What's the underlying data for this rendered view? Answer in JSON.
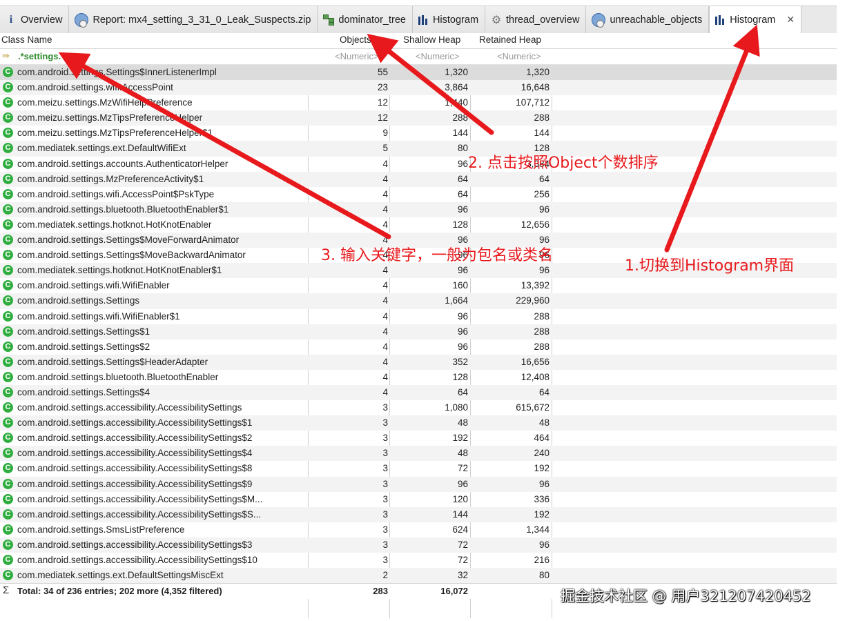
{
  "tabs": [
    {
      "icon": "info-icon",
      "label": "Overview",
      "active": false
    },
    {
      "icon": "report-icon",
      "label": "Report: mx4_setting_3_31_0_Leak_Suspects.zip",
      "active": false
    },
    {
      "icon": "tree-icon",
      "label": "dominator_tree",
      "active": false
    },
    {
      "icon": "histogram-icon",
      "label": "Histogram",
      "active": false
    },
    {
      "icon": "gear-icon",
      "label": "thread_overview",
      "active": false
    },
    {
      "icon": "report-icon",
      "label": "unreachable_objects",
      "active": false
    },
    {
      "icon": "histogram-icon",
      "label": "Histogram",
      "active": true,
      "close": "✕"
    }
  ],
  "columns": {
    "class_name": "Class Name",
    "objects": "Objects",
    "objects_sort": "⌄",
    "shallow": "Shallow Heap",
    "retained": "Retained Heap"
  },
  "filter": {
    "class_name": ".*settings.*",
    "objects": "<Numeric>",
    "shallow": "<Numeric>",
    "retained": "<Numeric>"
  },
  "rows": [
    {
      "name": "com.android.settings.Settings$InnerListenerImpl",
      "objects": "55",
      "shallow": "1,320",
      "retained": "1,320"
    },
    {
      "name": "com.android.settings.wifi.AccessPoint",
      "objects": "23",
      "shallow": "3,864",
      "retained": "16,648"
    },
    {
      "name": "com.meizu.settings.MzWifiHelpPreference",
      "objects": "12",
      "shallow": "1,440",
      "retained": "107,712"
    },
    {
      "name": "com.meizu.settings.MzTipsPreferenceHelper",
      "objects": "12",
      "shallow": "288",
      "retained": "288"
    },
    {
      "name": "com.meizu.settings.MzTipsPreferenceHelper$1",
      "objects": "9",
      "shallow": "144",
      "retained": "144"
    },
    {
      "name": "com.mediatek.settings.ext.DefaultWifiExt",
      "objects": "5",
      "shallow": "80",
      "retained": "128"
    },
    {
      "name": "com.android.settings.accounts.AuthenticatorHelper",
      "objects": "4",
      "shallow": "96",
      "retained": "3,384"
    },
    {
      "name": "com.android.settings.MzPreferenceActivity$1",
      "objects": "4",
      "shallow": "64",
      "retained": "64"
    },
    {
      "name": "com.android.settings.wifi.AccessPoint$PskType",
      "objects": "4",
      "shallow": "64",
      "retained": "256"
    },
    {
      "name": "com.android.settings.bluetooth.BluetoothEnabler$1",
      "objects": "4",
      "shallow": "96",
      "retained": "96"
    },
    {
      "name": "com.mediatek.settings.hotknot.HotKnotEnabler",
      "objects": "4",
      "shallow": "128",
      "retained": "12,656"
    },
    {
      "name": "com.android.settings.Settings$MoveForwardAnimator",
      "objects": "4",
      "shallow": "96",
      "retained": "96"
    },
    {
      "name": "com.android.settings.Settings$MoveBackwardAnimator",
      "objects": "4",
      "shallow": "96",
      "retained": "96"
    },
    {
      "name": "com.mediatek.settings.hotknot.HotKnotEnabler$1",
      "objects": "4",
      "shallow": "96",
      "retained": "96"
    },
    {
      "name": "com.android.settings.wifi.WifiEnabler",
      "objects": "4",
      "shallow": "160",
      "retained": "13,392"
    },
    {
      "name": "com.android.settings.Settings",
      "objects": "4",
      "shallow": "1,664",
      "retained": "229,960"
    },
    {
      "name": "com.android.settings.wifi.WifiEnabler$1",
      "objects": "4",
      "shallow": "96",
      "retained": "288"
    },
    {
      "name": "com.android.settings.Settings$1",
      "objects": "4",
      "shallow": "96",
      "retained": "288"
    },
    {
      "name": "com.android.settings.Settings$2",
      "objects": "4",
      "shallow": "96",
      "retained": "288"
    },
    {
      "name": "com.android.settings.Settings$HeaderAdapter",
      "objects": "4",
      "shallow": "352",
      "retained": "16,656"
    },
    {
      "name": "com.android.settings.bluetooth.BluetoothEnabler",
      "objects": "4",
      "shallow": "128",
      "retained": "12,408"
    },
    {
      "name": "com.android.settings.Settings$4",
      "objects": "4",
      "shallow": "64",
      "retained": "64"
    },
    {
      "name": "com.android.settings.accessibility.AccessibilitySettings",
      "objects": "3",
      "shallow": "1,080",
      "retained": "615,672"
    },
    {
      "name": "com.android.settings.accessibility.AccessibilitySettings$1",
      "objects": "3",
      "shallow": "48",
      "retained": "48"
    },
    {
      "name": "com.android.settings.accessibility.AccessibilitySettings$2",
      "objects": "3",
      "shallow": "192",
      "retained": "464"
    },
    {
      "name": "com.android.settings.accessibility.AccessibilitySettings$4",
      "objects": "3",
      "shallow": "48",
      "retained": "240"
    },
    {
      "name": "com.android.settings.accessibility.AccessibilitySettings$8",
      "objects": "3",
      "shallow": "72",
      "retained": "192"
    },
    {
      "name": "com.android.settings.accessibility.AccessibilitySettings$9",
      "objects": "3",
      "shallow": "96",
      "retained": "96"
    },
    {
      "name": "com.android.settings.accessibility.AccessibilitySettings$M...",
      "objects": "3",
      "shallow": "120",
      "retained": "336"
    },
    {
      "name": "com.android.settings.accessibility.AccessibilitySettings$S...",
      "objects": "3",
      "shallow": "144",
      "retained": "192"
    },
    {
      "name": "com.android.settings.SmsListPreference",
      "objects": "3",
      "shallow": "624",
      "retained": "1,344"
    },
    {
      "name": "com.android.settings.accessibility.AccessibilitySettings$3",
      "objects": "3",
      "shallow": "72",
      "retained": "96"
    },
    {
      "name": "com.android.settings.accessibility.AccessibilitySettings$10",
      "objects": "3",
      "shallow": "72",
      "retained": "216"
    },
    {
      "name": "com.mediatek.settings.ext.DefaultSettingsMiscExt",
      "objects": "2",
      "shallow": "32",
      "retained": "80"
    }
  ],
  "total": {
    "label": "Total: 34 of 236 entries; 202 more (4,352 filtered)",
    "objects": "283",
    "shallow": "16,072"
  },
  "class_icon_glyph": "C",
  "annotations": {
    "step1": "1.切换到Histogram界面",
    "step2": "2. 点击按照Object个数排序",
    "step3": "3. 输入关键字，一般为包名或类名"
  },
  "watermark": "掘金技术社区 @ 用户321207420452",
  "colors": {
    "annotation": "#e8191c",
    "class_icon": "#2fae3f",
    "selected_row": "#dcdcdc"
  }
}
